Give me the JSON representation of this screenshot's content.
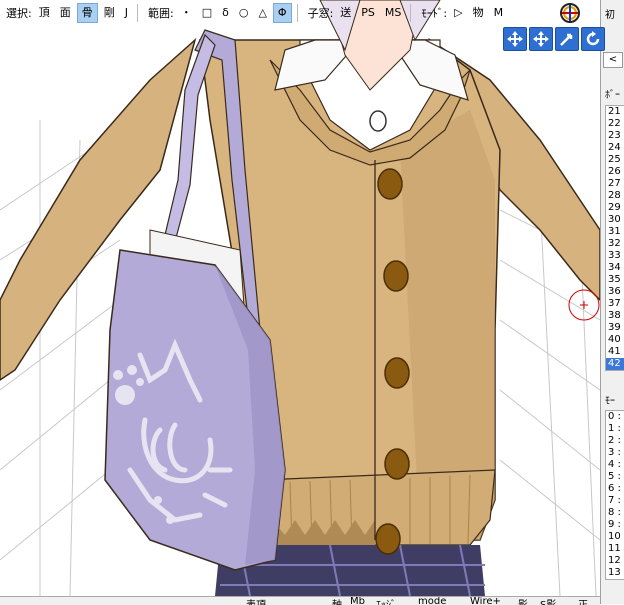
{
  "toolbar": {
    "select_label": "選択:",
    "select_items": [
      {
        "label": "頂",
        "active": false
      },
      {
        "label": "面",
        "active": false
      },
      {
        "label": "骨",
        "active": true
      },
      {
        "label": "剛",
        "active": false
      },
      {
        "label": "J",
        "active": false
      }
    ],
    "range_label": "範囲:",
    "range_items": [
      {
        "label": "・",
        "active": false
      },
      {
        "label": "□",
        "active": false
      },
      {
        "label": "δ",
        "active": false
      },
      {
        "label": "○",
        "active": false
      },
      {
        "label": "△",
        "active": false
      },
      {
        "label": "Φ",
        "active": true
      }
    ],
    "child_label": "子窓:",
    "child_items": [
      {
        "label": "送",
        "active": false
      },
      {
        "label": "PS",
        "active": false
      },
      {
        "label": "MS",
        "active": false
      }
    ],
    "mode_label": "ﾓｰﾄﾞ:",
    "mode_items": [
      {
        "label": "▷",
        "active": false
      },
      {
        "label": "物",
        "active": false
      },
      {
        "label": "M",
        "active": false
      }
    ]
  },
  "right_panel": {
    "top_label": "初",
    "arrow": "<",
    "bone_header": "ﾎﾞｰ",
    "bone_rows": [
      "21",
      "22",
      "23",
      "24",
      "25",
      "26",
      "27",
      "28",
      "29",
      "30",
      "31",
      "32",
      "33",
      "34",
      "35",
      "36",
      "37",
      "38",
      "39",
      "40",
      "41",
      "42"
    ],
    "bone_selected": "42",
    "morph_header": "ﾓｰ",
    "morph_rows": [
      "0 :",
      "1 :",
      "2 :",
      "3 :",
      "4 :",
      "5 :",
      "6 :",
      "7 :",
      "8 :",
      "9 :",
      "10",
      "11",
      "12",
      "13"
    ]
  },
  "bottom_bar": {
    "items": [
      "表項",
      "軸",
      "Mb",
      "ｴｯｼﾞ",
      "mode",
      "Wire+",
      "影",
      "S影",
      "正"
    ]
  },
  "colors": {
    "toolbar_active": "#a9cff2",
    "selection": "#3b78d8",
    "cardigan": "#d6b27e",
    "bag": "#b3aad8",
    "button": "#8a5a10"
  }
}
